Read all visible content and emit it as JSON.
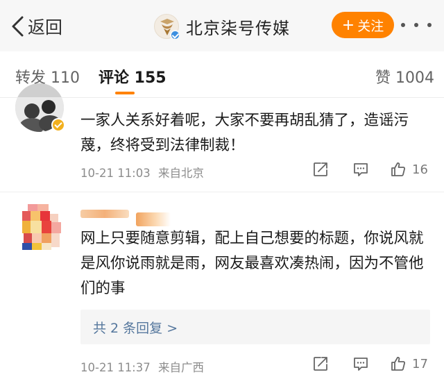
{
  "header": {
    "back_label": "返回",
    "account_name": "北京柒号传媒",
    "follow_label": "关注",
    "follow_plus": "+",
    "accent_color": "#ff8200",
    "verified_color": "#3c8fe0"
  },
  "tabs": {
    "repost_label": "转发 110",
    "comment_label": "评论 155",
    "like_label": "赞 1004"
  },
  "comments": [
    {
      "text": "一家人关系好着呢，大家不要再胡乱猜了，造谣污蔑，终将受到法律制裁！",
      "time": "10-21 11:03",
      "location": "来自北京",
      "likes": "16",
      "badge_color": "#f2b01e"
    },
    {
      "text": "网上只要随意剪辑，配上自己想要的标题，你说风就是风你说雨就是雨，网友最喜欢凑热闹，因为不管他们的事",
      "replies_label": "共 2 条回复 >",
      "time": "10-21 11:37",
      "location": "来自广西",
      "likes": "17"
    }
  ],
  "icons": {
    "back": "chevron-left-icon",
    "more": "more-dots-icon",
    "share": "share-icon",
    "comment": "comment-icon",
    "like": "thumbs-up-icon"
  }
}
